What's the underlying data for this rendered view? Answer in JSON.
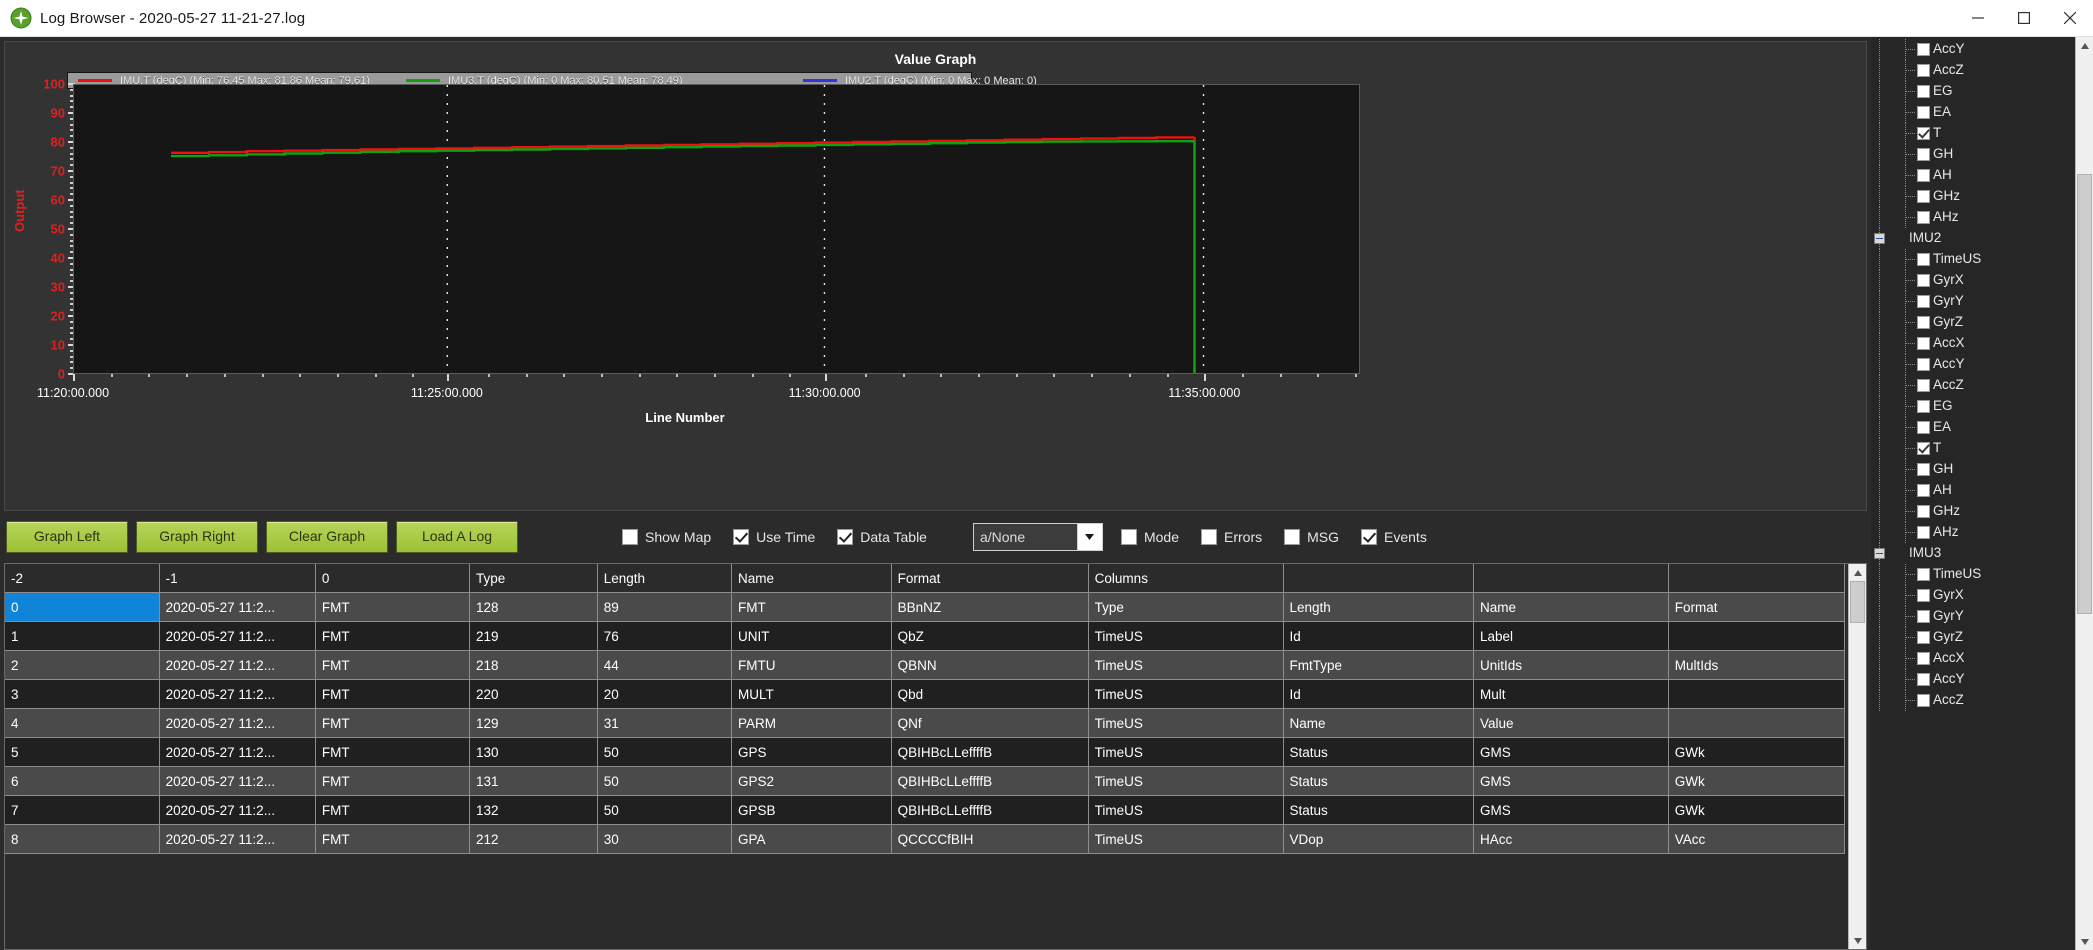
{
  "window": {
    "title": "Log Browser - 2020-05-27 11-21-27.log",
    "icon": "mission-planner-icon",
    "minimize": "minimize-icon",
    "maximize": "maximize-icon",
    "close": "close-icon"
  },
  "chart_data": {
    "type": "line",
    "title": "Value Graph",
    "xlabel": "Line Number",
    "ylabel": "Output",
    "ylim": [
      0,
      100
    ],
    "yticks": [
      0,
      10,
      20,
      30,
      40,
      50,
      60,
      70,
      80,
      90,
      100
    ],
    "xticklabels": [
      "11:20:00.000",
      "11:25:00.000",
      "11:30:00.000",
      "11:35:00.000"
    ],
    "grid": false,
    "legend_position": "top-left",
    "background": "#161616",
    "series": [
      {
        "name": "IMU.T",
        "unit": "degC",
        "color": "#ee1111",
        "min": 76.45,
        "max": 81.86,
        "mean": 79.61,
        "legend": "IMU.T  (degC)  (Min: 76.45  Max: 81.86  Mean: 79.61)",
        "values": [
          76.45,
          76.7,
          77.0,
          77.2,
          77.4,
          77.6,
          77.8,
          78.0,
          78.2,
          78.4,
          78.6,
          78.8,
          79.0,
          79.2,
          79.4,
          79.6,
          79.8,
          80.0,
          80.2,
          80.4,
          80.6,
          80.8,
          81.0,
          81.2,
          81.4,
          81.6,
          81.8,
          81.86
        ]
      },
      {
        "name": "IMU3.T",
        "unit": "degC",
        "color": "#10a010",
        "min": 0,
        "max": 80.51,
        "mean": 78.49,
        "legend": "IMU3.T  (degC)  (Min: 0  Max: 80.51  Mean: 78.49)",
        "values": [
          75.3,
          75.6,
          75.9,
          76.2,
          76.5,
          76.8,
          77.0,
          77.2,
          77.4,
          77.6,
          77.8,
          78.0,
          78.2,
          78.4,
          78.6,
          78.8,
          79.0,
          79.2,
          79.4,
          79.6,
          79.8,
          80.0,
          80.2,
          80.3,
          80.4,
          80.45,
          80.5,
          80.51
        ]
      },
      {
        "name": "IMU2.T",
        "unit": "degC",
        "color": "#3333dd",
        "min": 0,
        "max": 0,
        "mean": 0,
        "legend": "IMU2.T  (degC)  (Min: 0  Max: 0  Mean: 0)",
        "values": []
      }
    ],
    "event_markers": [
      "11:25:00.000",
      "11:30:00.000",
      "11:35:00.000"
    ]
  },
  "toolbar": {
    "buttons": [
      {
        "label": "Graph Left",
        "name": "graph-left-button"
      },
      {
        "label": "Graph Right",
        "name": "graph-right-button"
      },
      {
        "label": "Clear Graph",
        "name": "clear-graph-button"
      },
      {
        "label": "Load A Log",
        "name": "load-a-log-button"
      }
    ],
    "checkboxes_left": [
      {
        "label": "Show Map",
        "checked": false,
        "name": "show-map-checkbox"
      },
      {
        "label": "Use Time",
        "checked": true,
        "name": "use-time-checkbox"
      },
      {
        "label": "Data Table",
        "checked": true,
        "name": "data-table-checkbox"
      }
    ],
    "combo": {
      "value": "a/None",
      "name": "mode-select"
    },
    "checkboxes_right": [
      {
        "label": "Mode",
        "checked": false,
        "name": "mode-checkbox"
      },
      {
        "label": "Errors",
        "checked": false,
        "name": "errors-checkbox"
      },
      {
        "label": "MSG",
        "checked": false,
        "name": "msg-checkbox"
      },
      {
        "label": "Events",
        "checked": true,
        "name": "events-checkbox"
      }
    ]
  },
  "table": {
    "headers": [
      "-2",
      "-1",
      "0",
      "Type",
      "Length",
      "Name",
      "Format",
      "Columns",
      "",
      "",
      ""
    ],
    "selected_row": 0,
    "selected_col": 0,
    "rows": [
      [
        "0",
        "2020-05-27 11:2...",
        "FMT",
        "128",
        "89",
        "FMT",
        "BBnNZ",
        "Type",
        "Length",
        "Name",
        "Format"
      ],
      [
        "1",
        "2020-05-27 11:2...",
        "FMT",
        "219",
        "76",
        "UNIT",
        "QbZ",
        "TimeUS",
        "Id",
        "Label",
        ""
      ],
      [
        "2",
        "2020-05-27 11:2...",
        "FMT",
        "218",
        "44",
        "FMTU",
        "QBNN",
        "TimeUS",
        "FmtType",
        "UnitIds",
        "MultIds"
      ],
      [
        "3",
        "2020-05-27 11:2...",
        "FMT",
        "220",
        "20",
        "MULT",
        "Qbd",
        "TimeUS",
        "Id",
        "Mult",
        ""
      ],
      [
        "4",
        "2020-05-27 11:2...",
        "FMT",
        "129",
        "31",
        "PARM",
        "QNf",
        "TimeUS",
        "Name",
        "Value",
        ""
      ],
      [
        "5",
        "2020-05-27 11:2...",
        "FMT",
        "130",
        "50",
        "GPS",
        "QBIHBcLLeffffB",
        "TimeUS",
        "Status",
        "GMS",
        "GWk"
      ],
      [
        "6",
        "2020-05-27 11:2...",
        "FMT",
        "131",
        "50",
        "GPS2",
        "QBIHBcLLeffffB",
        "TimeUS",
        "Status",
        "GMS",
        "GWk"
      ],
      [
        "7",
        "2020-05-27 11:2...",
        "FMT",
        "132",
        "50",
        "GPSB",
        "QBIHBcLLeffffB",
        "TimeUS",
        "Status",
        "GMS",
        "GWk"
      ],
      [
        "8",
        "2020-05-27 11:2...",
        "FMT",
        "212",
        "30",
        "GPA",
        "QCCCCfBIH",
        "TimeUS",
        "VDop",
        "HAcc",
        "VAcc"
      ]
    ]
  },
  "tree": {
    "nodes": [
      {
        "label": "AccY",
        "type": "leaf",
        "checked": false
      },
      {
        "label": "AccZ",
        "type": "leaf",
        "checked": false
      },
      {
        "label": "EG",
        "type": "leaf",
        "checked": false
      },
      {
        "label": "EA",
        "type": "leaf",
        "checked": false
      },
      {
        "label": "T",
        "type": "leaf",
        "checked": true
      },
      {
        "label": "GH",
        "type": "leaf",
        "checked": false
      },
      {
        "label": "AH",
        "type": "leaf",
        "checked": false
      },
      {
        "label": "GHz",
        "type": "leaf",
        "checked": false
      },
      {
        "label": "AHz",
        "type": "leaf",
        "checked": false
      },
      {
        "label": "IMU2",
        "type": "group",
        "checked": false
      },
      {
        "label": "TimeUS",
        "type": "leaf",
        "checked": false
      },
      {
        "label": "GyrX",
        "type": "leaf",
        "checked": false
      },
      {
        "label": "GyrY",
        "type": "leaf",
        "checked": false
      },
      {
        "label": "GyrZ",
        "type": "leaf",
        "checked": false
      },
      {
        "label": "AccX",
        "type": "leaf",
        "checked": false
      },
      {
        "label": "AccY",
        "type": "leaf",
        "checked": false
      },
      {
        "label": "AccZ",
        "type": "leaf",
        "checked": false
      },
      {
        "label": "EG",
        "type": "leaf",
        "checked": false
      },
      {
        "label": "EA",
        "type": "leaf",
        "checked": false
      },
      {
        "label": "T",
        "type": "leaf",
        "checked": true
      },
      {
        "label": "GH",
        "type": "leaf",
        "checked": false
      },
      {
        "label": "AH",
        "type": "leaf",
        "checked": false
      },
      {
        "label": "GHz",
        "type": "leaf",
        "checked": false
      },
      {
        "label": "AHz",
        "type": "leaf",
        "checked": false
      },
      {
        "label": "IMU3",
        "type": "group",
        "checked": false
      },
      {
        "label": "TimeUS",
        "type": "leaf",
        "checked": false
      },
      {
        "label": "GyrX",
        "type": "leaf",
        "checked": false
      },
      {
        "label": "GyrY",
        "type": "leaf",
        "checked": false
      },
      {
        "label": "GyrZ",
        "type": "leaf",
        "checked": false
      },
      {
        "label": "AccX",
        "type": "leaf",
        "checked": false
      },
      {
        "label": "AccY",
        "type": "leaf",
        "checked": false
      },
      {
        "label": "AccZ",
        "type": "leaf",
        "checked": false
      }
    ]
  }
}
